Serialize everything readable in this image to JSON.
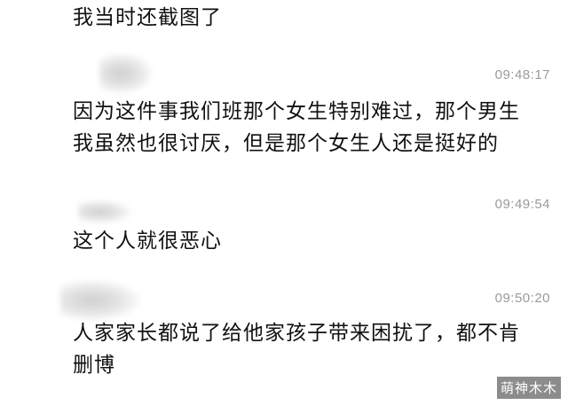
{
  "messages": [
    {
      "text": "我当时还截图了",
      "time": ""
    },
    {
      "sender": "",
      "time": "09:48:17",
      "lines": [
        "因为这件事我们班那个女生特别难过，那个男生",
        "我虽然也很讨厌，但是那个女生人还是挺好的"
      ]
    },
    {
      "sender": "",
      "time": "09:49:54",
      "lines": [
        "这个人就很恶心"
      ]
    },
    {
      "sender": "",
      "time": "09:50:20",
      "lines": [
        "人家家长都说了给他家孩子带来困扰了，都不肯",
        "删博"
      ]
    }
  ],
  "watermark": "萌神木木"
}
